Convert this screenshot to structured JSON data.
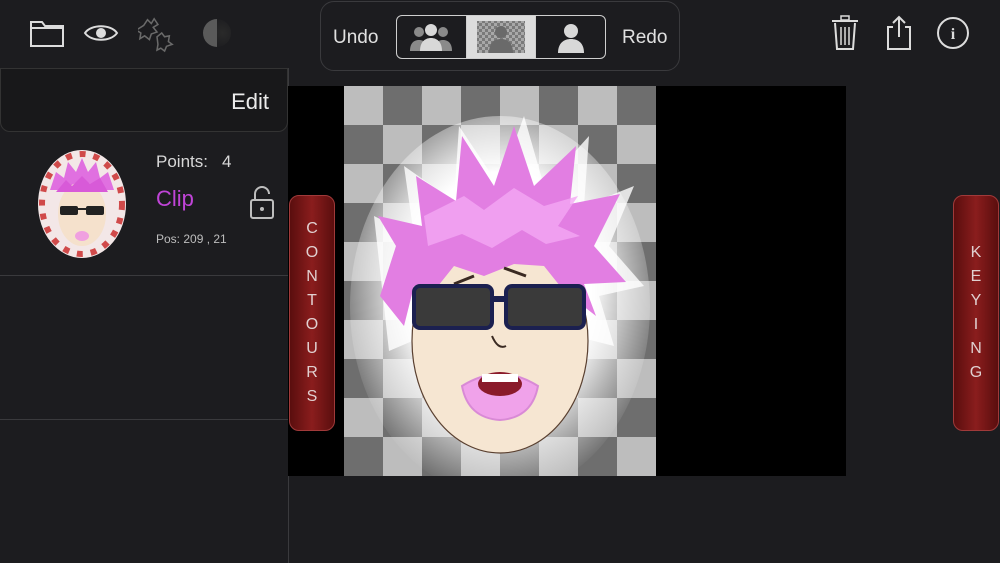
{
  "toolbar": {
    "undo_label": "Undo",
    "redo_label": "Redo",
    "left_icons": [
      "folder-icon",
      "eye-icon",
      "puzzle-icon",
      "contrast-icon"
    ],
    "right_icons": [
      "trash-icon",
      "share-icon",
      "info-icon"
    ],
    "segments": [
      "group-icon",
      "person-on-checker-icon",
      "person-icon"
    ],
    "selected_segment": 1
  },
  "sidebar": {
    "edit_label": "Edit",
    "layer": {
      "points_label": "Points:",
      "points_value": "4",
      "name": "Clip",
      "pos_text": "Pos: 209 , 21"
    }
  },
  "tabs": {
    "contours": "CONTOURS",
    "keying": "KEYING"
  },
  "colors": {
    "accent_purple": "#c044d8",
    "tab_red": "#8a1d1d",
    "background": "#1c1c1f"
  }
}
